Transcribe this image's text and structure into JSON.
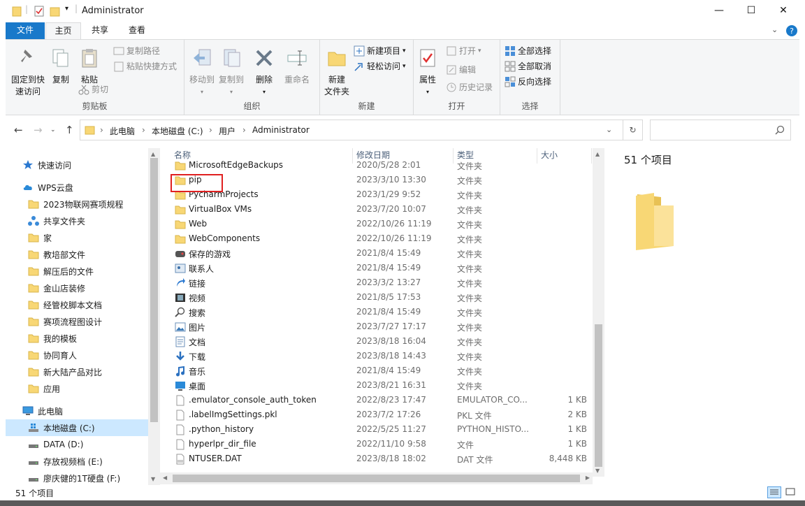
{
  "window": {
    "title": "Administrator",
    "controls": [
      "—",
      "☐",
      "✕"
    ]
  },
  "tabs": [
    "文件",
    "主页",
    "共享",
    "查看"
  ],
  "ribbon": {
    "clipboard": {
      "label": "剪贴板",
      "pin": "固定到快速访问",
      "pin_l1": "固定到快",
      "pin_l2": "速访问",
      "copy": "复制",
      "paste": "粘贴",
      "copy_path": "复制路径",
      "paste_shortcut": "粘贴快捷方式",
      "cut": "剪切"
    },
    "organize": {
      "label": "组织",
      "move_to": "移动到",
      "copy_to": "复制到",
      "delete": "删除",
      "rename": "重命名"
    },
    "new": {
      "label": "新建",
      "new_folder_l1": "新建",
      "new_folder_l2": "文件夹",
      "new_item": "新建项目",
      "easy_access": "轻松访问"
    },
    "open": {
      "label": "打开",
      "properties": "属性",
      "open": "打开",
      "edit": "编辑",
      "history": "历史记录"
    },
    "select": {
      "label": "选择",
      "select_all": "全部选择",
      "select_none": "全部取消",
      "invert": "反向选择"
    }
  },
  "address": {
    "crumbs": [
      "此电脑",
      "本地磁盘 (C:)",
      "用户",
      "Administrator"
    ]
  },
  "nav": {
    "quick_access": "快速访问",
    "wps": "WPS云盘",
    "wps_items": [
      "2023物联网赛项规程",
      "共享文件夹",
      "家",
      "教培部文件",
      "解压后的文件",
      "金山店装修",
      "经管校脚本文档",
      "赛项流程图设计",
      "我的模板",
      "协同育人",
      "新大陆产品对比",
      "应用"
    ],
    "this_pc": "此电脑",
    "drives": [
      "本地磁盘 (C:)",
      "DATA (D:)",
      "存放视频档 (E:)",
      "廖庆健的1T硬盘 (F:)"
    ]
  },
  "columns": {
    "name": "名称",
    "date": "修改日期",
    "type": "类型",
    "size": "大小"
  },
  "files": [
    {
      "name": "MicrosoftEdgeBackups",
      "date": "2020/5/28 2:01",
      "type": "文件夹",
      "size": "",
      "icon": "folder-icon"
    },
    {
      "name": "pip",
      "date": "2023/3/10 13:30",
      "type": "文件夹",
      "size": "",
      "icon": "folder-icon"
    },
    {
      "name": "PycharmProjects",
      "date": "2023/1/29 9:52",
      "type": "文件夹",
      "size": "",
      "icon": "folder-icon"
    },
    {
      "name": "VirtualBox VMs",
      "date": "2023/7/20 10:07",
      "type": "文件夹",
      "size": "",
      "icon": "folder-icon"
    },
    {
      "name": "Web",
      "date": "2022/10/26 11:19",
      "type": "文件夹",
      "size": "",
      "icon": "folder-icon"
    },
    {
      "name": "WebComponents",
      "date": "2022/10/26 11:19",
      "type": "文件夹",
      "size": "",
      "icon": "folder-icon"
    },
    {
      "name": "保存的游戏",
      "date": "2021/8/4 15:49",
      "type": "文件夹",
      "size": "",
      "icon": "games-icon"
    },
    {
      "name": "联系人",
      "date": "2021/8/4 15:49",
      "type": "文件夹",
      "size": "",
      "icon": "contacts-icon"
    },
    {
      "name": "链接",
      "date": "2023/3/2 13:27",
      "type": "文件夹",
      "size": "",
      "icon": "link-icon"
    },
    {
      "name": "视频",
      "date": "2021/8/5 17:53",
      "type": "文件夹",
      "size": "",
      "icon": "video-icon"
    },
    {
      "name": "搜索",
      "date": "2021/8/4 15:49",
      "type": "文件夹",
      "size": "",
      "icon": "search-icon"
    },
    {
      "name": "图片",
      "date": "2023/7/27 17:17",
      "type": "文件夹",
      "size": "",
      "icon": "pictures-icon"
    },
    {
      "name": "文档",
      "date": "2023/8/18 16:04",
      "type": "文件夹",
      "size": "",
      "icon": "documents-icon"
    },
    {
      "name": "下载",
      "date": "2023/8/18 14:43",
      "type": "文件夹",
      "size": "",
      "icon": "download-icon"
    },
    {
      "name": "音乐",
      "date": "2021/8/4 15:49",
      "type": "文件夹",
      "size": "",
      "icon": "music-icon"
    },
    {
      "name": "桌面",
      "date": "2023/8/21 16:31",
      "type": "文件夹",
      "size": "",
      "icon": "desktop-icon"
    },
    {
      "name": ".emulator_console_auth_token",
      "date": "2022/8/23 17:47",
      "type": "EMULATOR_CO...",
      "size": "1 KB",
      "icon": "file-icon"
    },
    {
      "name": ".labelImgSettings.pkl",
      "date": "2023/7/2 17:26",
      "type": "PKL 文件",
      "size": "2 KB",
      "icon": "file-icon"
    },
    {
      "name": ".python_history",
      "date": "2022/5/25 11:27",
      "type": "PYTHON_HISTO...",
      "size": "1 KB",
      "icon": "file-icon"
    },
    {
      "name": "hyperlpr_dir_file",
      "date": "2022/11/10 9:58",
      "type": "文件",
      "size": "1 KB",
      "icon": "file-icon"
    },
    {
      "name": "NTUSER.DAT",
      "date": "2023/8/18 18:02",
      "type": "DAT 文件",
      "size": "8,448 KB",
      "icon": "dat-file-icon"
    }
  ],
  "preview": {
    "count": "51 个项目"
  },
  "status": {
    "count": "51 个项目"
  },
  "colors": {
    "accent": "#1979ca",
    "selection": "#cce8ff",
    "folder": "#f8d775",
    "highlight_box": "#e02020"
  }
}
